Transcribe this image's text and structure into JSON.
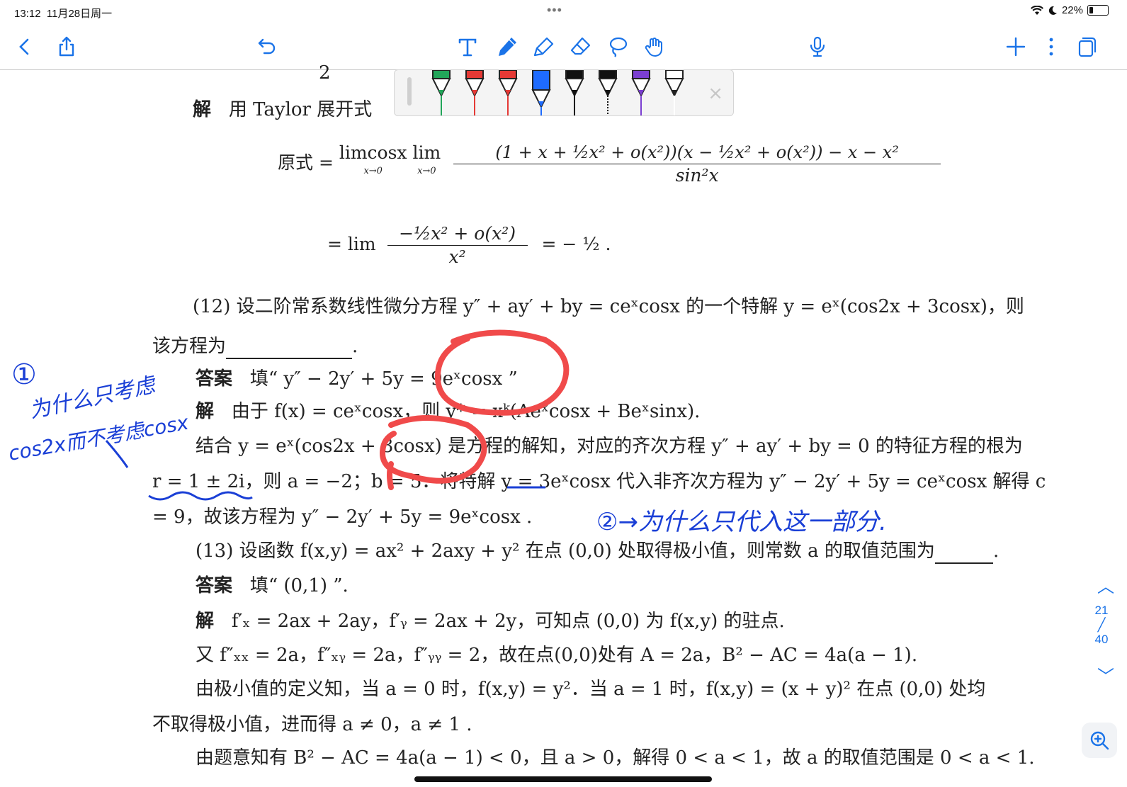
{
  "status": {
    "time": "13:12",
    "date": "11月28日周一",
    "dots": "•••",
    "battery": "22%",
    "battery_level": 0.22
  },
  "toolbar": {
    "icons": [
      "back-icon",
      "share-icon",
      "undo-icon",
      "text-tool-icon",
      "pen-tool-icon",
      "highlighter-icon",
      "eraser-icon",
      "lasso-icon",
      "hand-icon",
      "microphone-icon",
      "add-icon",
      "more-icon",
      "pages-icon"
    ]
  },
  "palette": {
    "pens": [
      "#22a65a",
      "#e53935",
      "#e53935",
      "#1e6bff",
      "#111111",
      "#111111",
      "#7b3fd1",
      "#ffffff"
    ],
    "close": "×"
  },
  "doc": {
    "top_partial": "2",
    "sol1_label": "解",
    "sol1_text": "用 Taylor 展开式",
    "eq1_prefix": "原式 = ",
    "eq1_lim1": "limcosx",
    "eq1_lim_sub": "x→0",
    "eq1_lim2": "lim",
    "eq1_num": "(1 + x + ½x² + o(x²))(x − ½x² + o(x²)) − x − x²",
    "eq1_den": "sin²x",
    "eq2_prefix": "= lim",
    "eq2_num": "−½x² + o(x²)",
    "eq2_den": "x²",
    "eq2_result": "= − ½ .",
    "q12_text": "(12) 设二阶常系数线性微分方程 y″ + ay′ + by = ceˣcosx 的一个特解 y = eˣ(cos2x + 3cosx)，则",
    "q12_line2": "该方程为",
    "q12_line2_end": ".",
    "ans12_label": "答案",
    "ans12_text": "填“ y″ − 2y′ + 5y = 9eˣcosx ”",
    "sol12_label": "解",
    "sol12_text": "由于 f(x) = ceˣcosx，则 y* = xᵏ(Aeˣcosx + Beˣsinx).",
    "sol12_line2": "结合 y = eˣ(cos2x + 3cosx) 是方程的解知，对应的齐次方程 y″ + ay′ + by = 0 的特征方程的根为",
    "sol12_line3": "r = 1 ± 2i，则 a = −2；b = 5．将特解 y = 3eˣcosx 代入非齐次方程为 y″ − 2y′ + 5y = ceˣcosx 解得 c",
    "sol12_line4": "= 9，故该方程为 y″ − 2y′ + 5y = 9eˣcosx .",
    "q13_text": "(13) 设函数 f(x,y) = ax² + 2axy + y² 在点 (0,0) 处取得极小值，则常数 a 的取值范围为",
    "q13_end": ".",
    "ans13_label": "答案",
    "ans13_text": "填“ (0,1) ”.",
    "sol13_label": "解",
    "sol13_text": "f′ₓ = 2ax + 2ay，f′ᵧ = 2ax + 2y，可知点 (0,0) 为 f(x,y) 的驻点.",
    "sol13_line2": "又 f″ₓₓ = 2a，f″ₓᵧ = 2a，f″ᵧᵧ = 2，故在点(0,0)处有 A = 2a，B² − AC = 4a(a − 1).",
    "sol13_line3": "由极小值的定义知，当 a = 0 时，f(x,y) = y²．当 a = 1 时，f(x,y) = (x + y)² 在点 (0,0) 处均",
    "sol13_line4": "不取得极小值，进而得 a ≠ 0，a ≠ 1 .",
    "sol13_line5": "由题意知有 B² − AC = 4a(a − 1) < 0，且 a > 0，解得 0 < a < 1，故 a 的取值范围是 0 < a < 1."
  },
  "handwriting": {
    "note1_num": "①",
    "note1_line1": "为什么只考虑",
    "note1_line2": "cos2x而不考虑cosx",
    "note2": "②→为什么只代入这一部分."
  },
  "pager": {
    "current": "21",
    "total": "40",
    "up": "︿",
    "down": "﹀"
  }
}
